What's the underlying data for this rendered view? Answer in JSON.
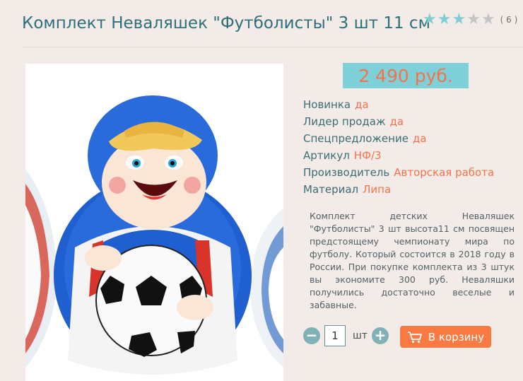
{
  "product": {
    "title": "Комплект Неваляшек \"Футболисты\" 3 шт 11 см",
    "rating": {
      "value": 3,
      "max": 5,
      "count": "( 6 )"
    },
    "price": "2 490 руб.",
    "properties": [
      {
        "key": "Новинка",
        "value": "да"
      },
      {
        "key": "Лидер продаж",
        "value": "да"
      },
      {
        "key": "Спецпредложение",
        "value": "да"
      },
      {
        "key": "Артикул",
        "value": "НФ/3"
      },
      {
        "key": "Производитель",
        "value": "Авторская работа"
      },
      {
        "key": "Материал",
        "value": "Липа"
      }
    ],
    "description": "Комплект детских Неваляшек \"Футболисты\" 3 шт высота11 см посвящен предстоящему чемпионату мира по футболу. Который состоится в 2018 году в России. При покупке комплекта из 3 штук вы экономите 300 руб. Неваляшки получились достаточно веселые и забавные.",
    "quantity": {
      "value": "1",
      "unit": "шт",
      "minus": "−",
      "plus": "+"
    },
    "cart_button": "В корзину",
    "image_icon": "roly-poly-doll-football-photo"
  },
  "colors": {
    "title": "#2f6f79",
    "accent": "#f4734d",
    "price_bg": "#7ed1d9",
    "cart_bg": "#f97b43",
    "star_on": "#7fcfd5",
    "star_off": "#c4c4c4"
  }
}
